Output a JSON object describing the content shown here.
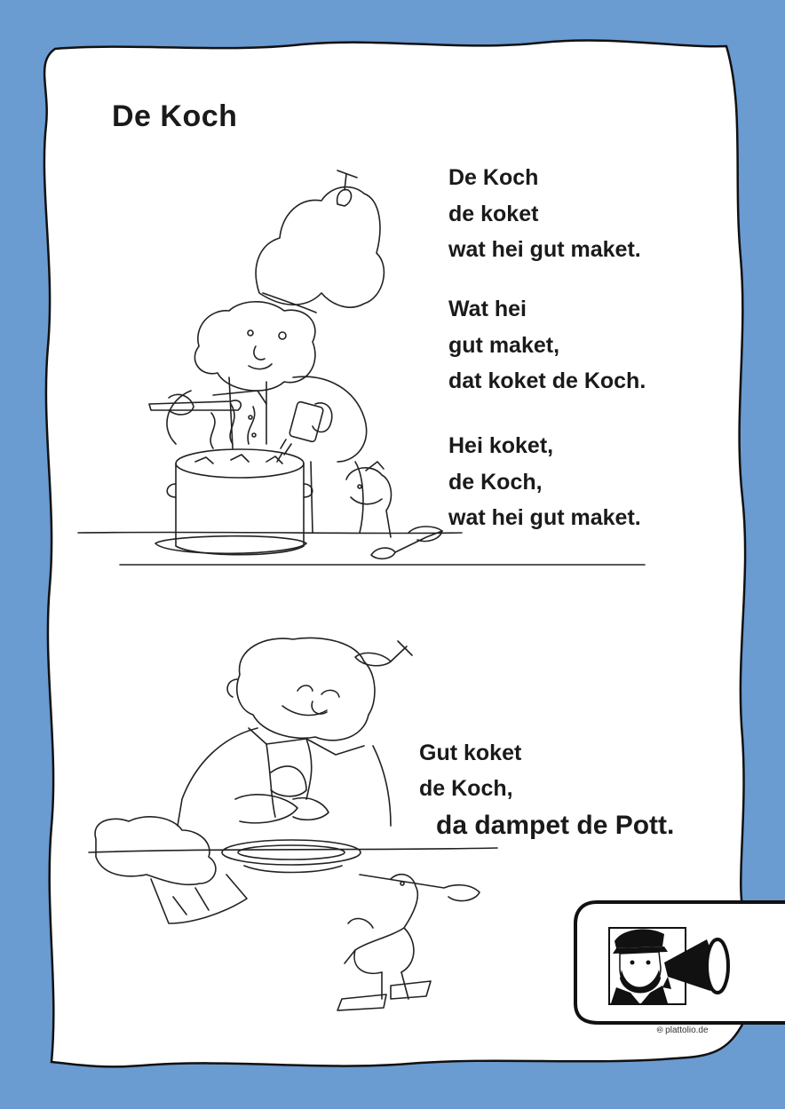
{
  "title": "De Koch",
  "stanzas": [
    {
      "lines": [
        "De Koch",
        "de koket",
        "wat hei gut maket."
      ]
    },
    {
      "lines": [
        "Wat hei",
        "gut maket,",
        "dat koket de Koch."
      ]
    },
    {
      "lines": [
        "Hei koket,",
        "de Koch,",
        "wat hei gut maket."
      ]
    },
    {
      "lines": [
        "Gut koket",
        "de Koch,"
      ],
      "emphasis": "da dampet de Pott."
    }
  ],
  "footer": {
    "symbol": "cc",
    "site": "plattolio.de"
  },
  "colors": {
    "border": "#6a9bd1",
    "paper": "#ffffff",
    "ink": "#1a1a1a"
  },
  "icons": [
    "chef-cooking-illustration",
    "chef-eating-illustration",
    "captain-megaphone-icon"
  ]
}
